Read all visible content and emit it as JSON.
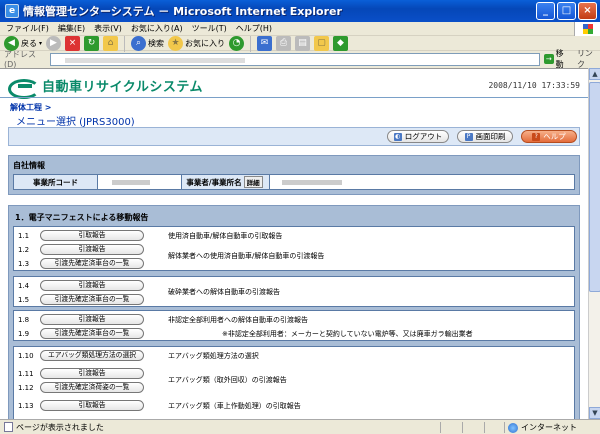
{
  "window": {
    "title": "情報管理センターシステム － Microsoft Internet Explorer",
    "buttons": [
      "_",
      "□",
      "×"
    ]
  },
  "menu": [
    "ファイル(F)",
    "編集(E)",
    "表示(V)",
    "お気に入り(A)",
    "ツール(T)",
    "ヘルプ(H)"
  ],
  "toolbar": {
    "back": "戻る",
    "search": "検索",
    "favorites": "お気に入り"
  },
  "address": {
    "label": "アドレス(D)",
    "go": "移動",
    "links": "リンク"
  },
  "header": {
    "system_name": "自動車リサイクルシステム",
    "datetime": "2008/11/10 17:33:59"
  },
  "breadcrumb": "解体工程 >",
  "page_title": "メニュー選択 (JPRS3000)",
  "actions": {
    "logout": "ログアウト",
    "print": "画面印刷",
    "help": "ヘルプ"
  },
  "company": {
    "section": "自社情報",
    "code_label": "事業所コード",
    "name_label": "事業者/事業所名",
    "detail": "詳細"
  },
  "ewm": {
    "section": "1．電子マニフェストによる移動報告",
    "rows": [
      {
        "num": "1.1",
        "button": "引取報告",
        "desc": "使用済自動車/解体自動車の引取報告"
      },
      {
        "num": "1.2",
        "button": "引渡報告",
        "desc": "解体業者への使用済自動車/解体自動車の引渡報告"
      },
      {
        "num": "1.3",
        "button": "引渡先確定済車台の一覧",
        "desc": ""
      },
      {
        "num": "1.4",
        "button": "引渡報告",
        "desc": "破砕業者への解体自動車の引渡報告"
      },
      {
        "num": "1.5",
        "button": "引渡先確定済車台の一覧",
        "desc": ""
      },
      {
        "num": "1.8",
        "button": "引渡報告",
        "desc": "非認定全部利用者への解体自動車の引渡報告"
      },
      {
        "num": "1.9",
        "button": "引渡先確定済車台の一覧",
        "desc": ""
      },
      {
        "num": "1.10",
        "button": "エアバッグ類処理方法の選択",
        "desc": "エアバッグ類処理方法の選択"
      },
      {
        "num": "1.11",
        "button": "引渡報告",
        "desc": "エアバッグ類（取外回収）の引渡報告"
      },
      {
        "num": "1.12",
        "button": "引渡先確定済荷姿の一覧",
        "desc": ""
      },
      {
        "num": "1.13",
        "button": "引取報告",
        "desc": "エアバッグ類（車上作動処理）の引取報告"
      }
    ],
    "note": "※非認定全部利用者：メーカーと契約していない電炉等、又は廃車ガラ輸出業者"
  },
  "status": {
    "text": "ページが表示されました",
    "zone": "インターネット"
  }
}
